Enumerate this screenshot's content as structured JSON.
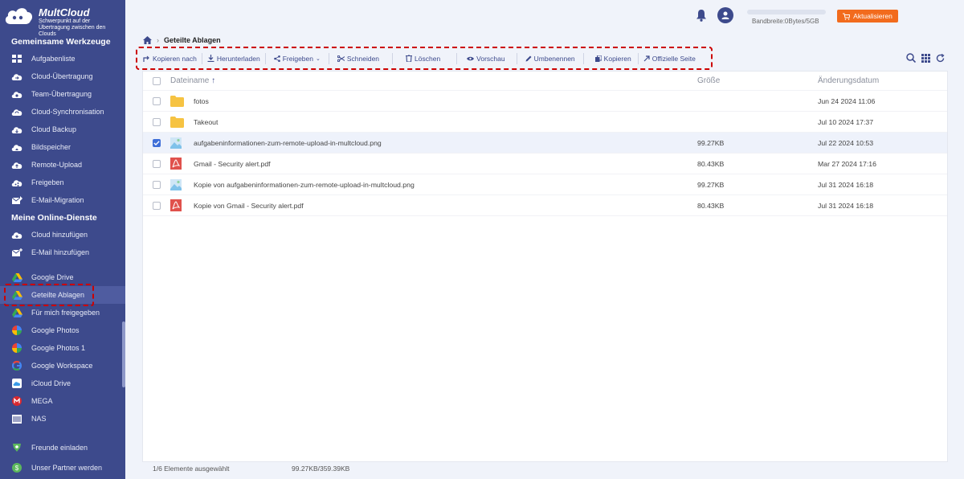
{
  "app": {
    "name": "MultCloud",
    "tagline": "Schwerpunkt auf der Übertragung zwischen den Clouds"
  },
  "sidebar": {
    "section_tools": "Gemeinsame Werkzeuge",
    "tools": [
      {
        "label": "Aufgabenliste",
        "icon": "list-icon"
      },
      {
        "label": "Cloud-Übertragung",
        "icon": "cloud-transfer-icon"
      },
      {
        "label": "Team-Übertragung",
        "icon": "team-transfer-icon"
      },
      {
        "label": "Cloud-Synchronisation",
        "icon": "cloud-sync-icon"
      },
      {
        "label": "Cloud Backup",
        "icon": "cloud-backup-icon"
      },
      {
        "label": "Bildspeicher",
        "icon": "image-save-icon"
      },
      {
        "label": "Remote-Upload",
        "icon": "remote-upload-icon"
      },
      {
        "label": "Freigeben",
        "icon": "share-icon"
      },
      {
        "label": "E-Mail-Migration",
        "icon": "email-migration-icon"
      }
    ],
    "section_services": "Meine Online-Dienste",
    "services": [
      {
        "label": "Cloud hinzufügen",
        "icon": "add-cloud-icon"
      },
      {
        "label": "E-Mail hinzufügen",
        "icon": "add-email-icon"
      },
      {
        "label": "Google Drive",
        "icon": "google-drive-icon"
      },
      {
        "label": "Geteilte Ablagen",
        "icon": "shared-drive-icon"
      },
      {
        "label": "Für mich freigegeben",
        "icon": "shared-with-me-icon"
      },
      {
        "label": "Google Photos",
        "icon": "google-photos-icon"
      },
      {
        "label": "Google Photos 1",
        "icon": "google-photos-icon"
      },
      {
        "label": "Google Workspace",
        "icon": "google-workspace-icon"
      },
      {
        "label": "iCloud Drive",
        "icon": "icloud-icon"
      },
      {
        "label": "MEGA",
        "icon": "mega-icon"
      },
      {
        "label": "NAS",
        "icon": "nas-icon"
      }
    ],
    "footer": [
      {
        "label": "Freunde einladen",
        "icon": "invite-icon"
      },
      {
        "label": "Unser Partner werden",
        "icon": "partner-icon"
      }
    ]
  },
  "topbar": {
    "bandwidth": "Bandbreite:0Bytes/5GB",
    "upgrade": "Aktualisieren"
  },
  "breadcrumb": {
    "current": "Geteilte Ablagen"
  },
  "toolbar": [
    {
      "label": "Kopieren nach",
      "icon": "copy-to-icon"
    },
    {
      "label": "Herunterladen",
      "icon": "download-icon"
    },
    {
      "label": "Freigeben",
      "icon": "share-icon"
    },
    {
      "label": "Schneiden",
      "icon": "cut-icon"
    },
    {
      "label": "Löschen",
      "icon": "trash-icon"
    },
    {
      "label": "Vorschau",
      "icon": "eye-icon"
    },
    {
      "label": "Umbenennen",
      "icon": "pencil-icon"
    },
    {
      "label": "Kopieren",
      "icon": "copy-icon"
    },
    {
      "label": "Offizielle Seite",
      "icon": "external-icon"
    }
  ],
  "table": {
    "col_name": "Dateiname",
    "col_size": "Größe",
    "col_date": "Änderungsdatum",
    "rows": [
      {
        "name": "fotos",
        "type": "folder",
        "size": "",
        "date": "Jun 24 2024 11:06",
        "checked": false
      },
      {
        "name": "Takeout",
        "type": "folder",
        "size": "",
        "date": "Jul 10 2024 17:37",
        "checked": false
      },
      {
        "name": "aufgabeninformationen-zum-remote-upload-in-multcloud.png",
        "type": "image",
        "size": "99.27KB",
        "date": "Jul 22 2024 10:53",
        "checked": true
      },
      {
        "name": "Gmail - Security alert.pdf",
        "type": "pdf",
        "size": "80.43KB",
        "date": "Mar 27 2024 17:16",
        "checked": false
      },
      {
        "name": "Kopie von aufgabeninformationen-zum-remote-upload-in-multcloud.png",
        "type": "image",
        "size": "99.27KB",
        "date": "Jul 31 2024 16:18",
        "checked": false
      },
      {
        "name": "Kopie von Gmail - Security alert.pdf",
        "type": "pdf",
        "size": "80.43KB",
        "date": "Jul 31 2024 16:18",
        "checked": false
      }
    ]
  },
  "status": {
    "selected": "1/6 Elemente ausgewählt",
    "size": "99.27KB/359.39KB"
  },
  "colors": {
    "sidebar": "#3d4a8c",
    "accent": "#f26b1d",
    "folder": "#f6c342",
    "pdf": "#e0514c",
    "highlight_border": "#cc0000"
  }
}
